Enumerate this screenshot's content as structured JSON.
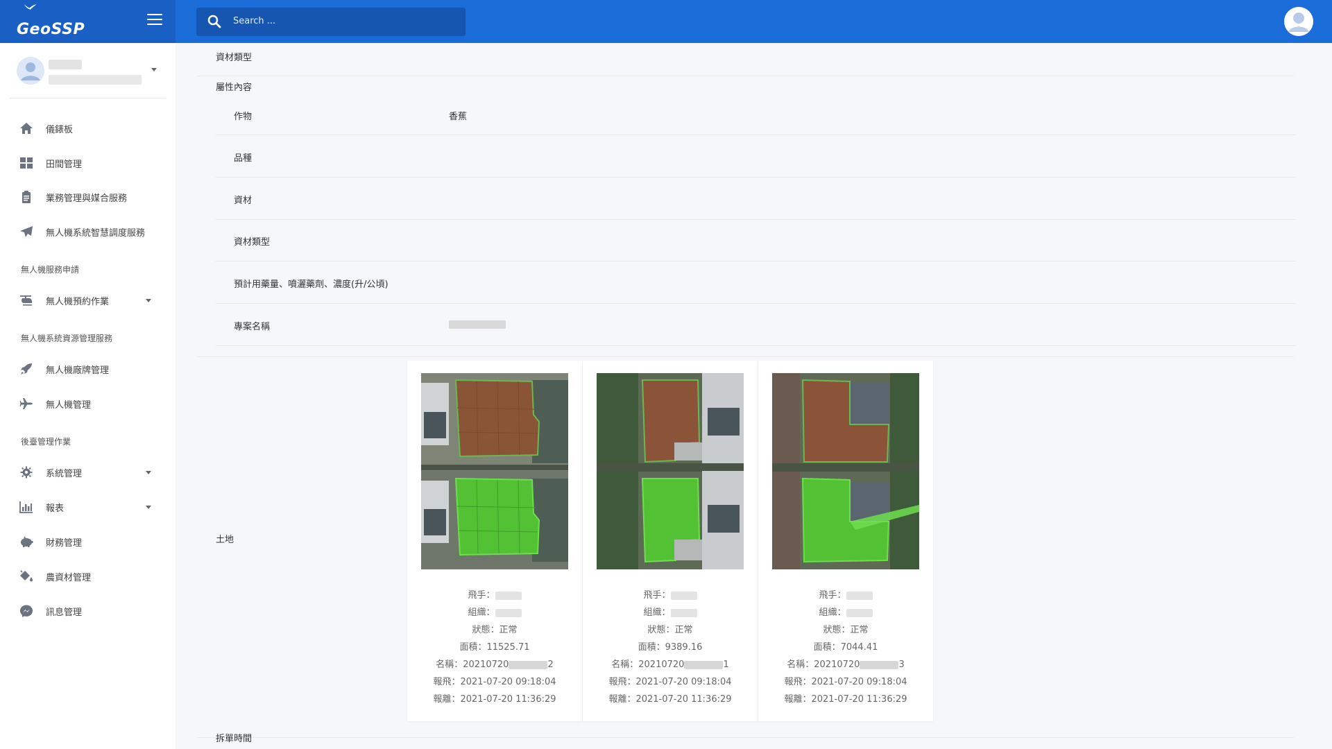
{
  "header": {
    "logo_text": "GeoSSP",
    "search_placeholder": "Search ..."
  },
  "sidebar": {
    "items": [
      {
        "label": "儀錶板",
        "icon": "home-icon"
      },
      {
        "label": "田間管理",
        "icon": "grid-icon"
      },
      {
        "label": "業務管理與媒合服務",
        "icon": "clipboard-icon"
      },
      {
        "label": "無人機系統智慧調度服務",
        "icon": "paper-plane-icon"
      }
    ],
    "section_drone_service": "無人機服務申請",
    "drone_booking": "無人機預約作業",
    "section_resource": "無人機系統資源管理服務",
    "brand_mgmt": "無人機廠牌管理",
    "drone_mgmt": "無人機管理",
    "section_backend": "後臺管理作業",
    "system_mgmt": "系統管理",
    "report": "報表",
    "finance_mgmt": "財務管理",
    "material_mgmt": "農資材管理",
    "message_mgmt": "訊息管理"
  },
  "form": {
    "material_type_top": "資材類型",
    "attribute_content": "屬性內容",
    "rows": [
      {
        "label": "作物",
        "value": "香蕉"
      },
      {
        "label": "品種",
        "value": ""
      },
      {
        "label": "資材",
        "value": ""
      },
      {
        "label": "資材類型",
        "value": ""
      },
      {
        "label": "預計用藥量、噴灑藥劑、濃度(升/公頃)",
        "value": ""
      },
      {
        "label": "專案名稱",
        "value": ""
      }
    ],
    "land_label": "土地",
    "split_time_label": "拆單時間"
  },
  "cards": [
    {
      "pilot": "飛手：",
      "org": "組織：",
      "status": "狀態：正常",
      "area": "面積：11525.71",
      "name_prefix": "名稱：20210720",
      "name_suffix": "2",
      "report_fly": "報飛：2021-07-20 09:18:04",
      "report_leave": "報離：2021-07-20 11:36:29"
    },
    {
      "pilot": "飛手：",
      "org": "組織：",
      "status": "狀態：正常",
      "area": "面積：9389.16",
      "name_prefix": "名稱：20210720",
      "name_suffix": "1",
      "report_fly": "報飛：2021-07-20 09:18:04",
      "report_leave": "報離：2021-07-20 11:36:29"
    },
    {
      "pilot": "飛手：",
      "org": "組織：",
      "status": "狀態：正常",
      "area": "面積：7044.41",
      "name_prefix": "名稱：20210720",
      "name_suffix": "3",
      "report_fly": "報飛：2021-07-20 09:18:04",
      "report_leave": "報離：2021-07-20 11:36:29"
    }
  ],
  "colors": {
    "topbar": "#1a6cd8",
    "logo_bg": "#1a5fc4",
    "field_brown": "#8b5a3a",
    "field_green": "#5cc24a"
  }
}
